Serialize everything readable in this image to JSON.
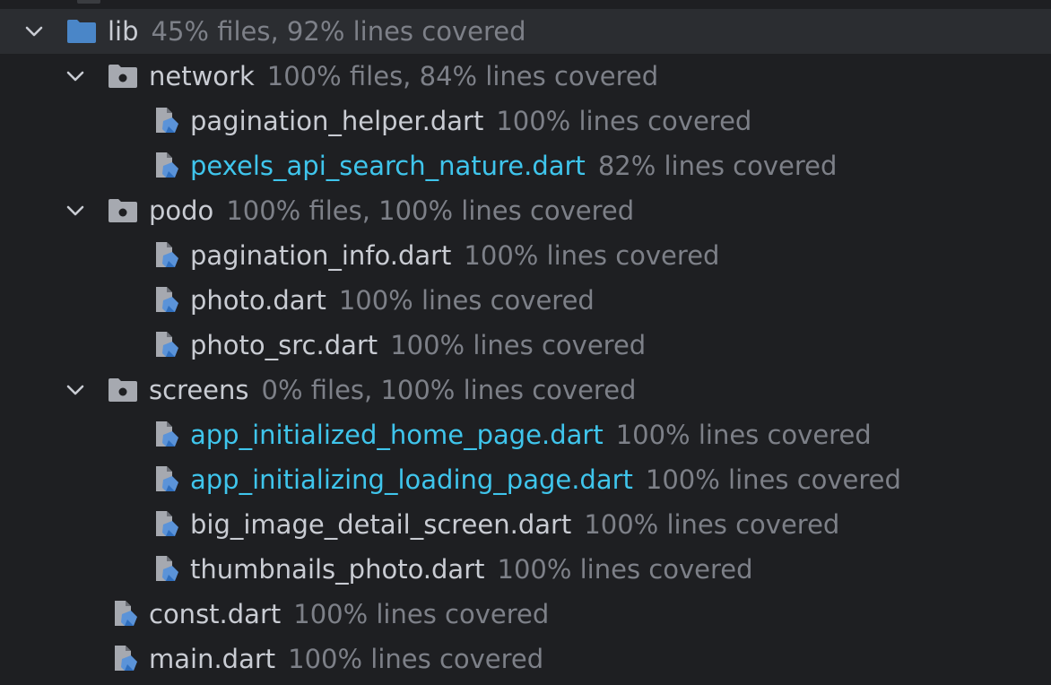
{
  "tree": {
    "root": {
      "name": "lib",
      "coverage": "45% files, 92% lines covered",
      "expanded": true,
      "folder_color": "#4a86c8",
      "children": {
        "network": {
          "name": "network",
          "coverage": "100% files, 84% lines covered",
          "expanded": true,
          "files": [
            {
              "name": "pagination_helper.dart",
              "coverage": "100% lines covered",
              "modified": false
            },
            {
              "name": "pexels_api_search_nature.dart",
              "coverage": "82% lines covered",
              "modified": true
            }
          ]
        },
        "podo": {
          "name": "podo",
          "coverage": "100% files, 100% lines covered",
          "expanded": true,
          "files": [
            {
              "name": "pagination_info.dart",
              "coverage": "100% lines covered",
              "modified": false
            },
            {
              "name": "photo.dart",
              "coverage": "100% lines covered",
              "modified": false
            },
            {
              "name": "photo_src.dart",
              "coverage": "100% lines covered",
              "modified": false
            }
          ]
        },
        "screens": {
          "name": "screens",
          "coverage": "0% files, 100% lines covered",
          "expanded": true,
          "files": [
            {
              "name": "app_initialized_home_page.dart",
              "coverage": "100% lines covered",
              "modified": true
            },
            {
              "name": "app_initializing_loading_page.dart",
              "coverage": "100% lines covered",
              "modified": true
            },
            {
              "name": "big_image_detail_screen.dart",
              "coverage": "100% lines covered",
              "modified": false
            },
            {
              "name": "thumbnails_photo.dart",
              "coverage": "100% lines covered",
              "modified": false
            }
          ]
        },
        "root_files": [
          {
            "name": "const.dart",
            "coverage": "100% lines covered",
            "modified": false
          },
          {
            "name": "main.dart",
            "coverage": "100% lines covered",
            "modified": false
          }
        ]
      }
    }
  },
  "colors": {
    "background": "#1e1f22",
    "selected_row": "#2b2d31",
    "text": "#c9ccd3",
    "coverage_text": "#7d8088",
    "modified_text": "#3fc5ec",
    "dart_icon": "#5b93d8"
  },
  "icons": {
    "chevron": "chevron-down-icon",
    "folder_root": "folder-icon",
    "folder_package": "package-folder-icon",
    "file": "dart-file-icon"
  }
}
